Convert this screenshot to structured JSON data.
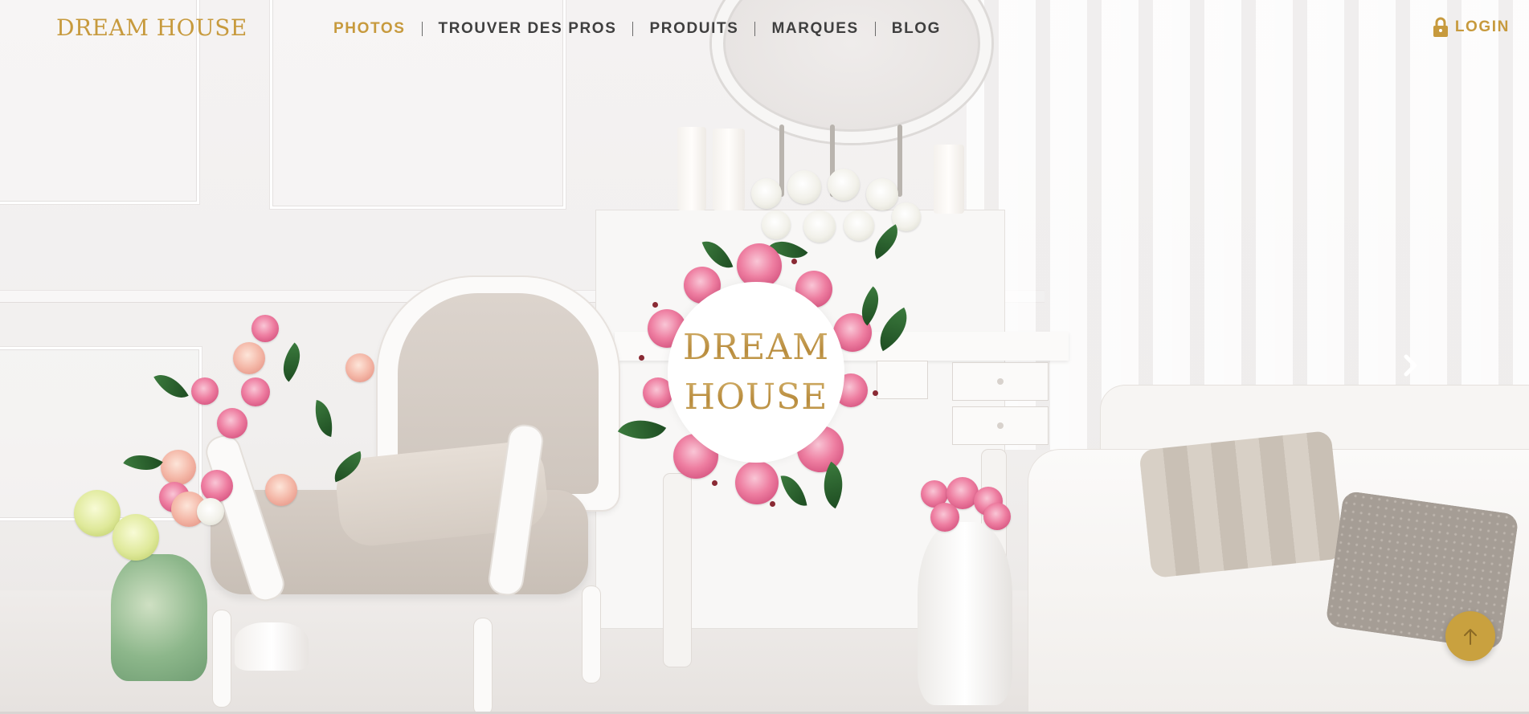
{
  "brand": {
    "name": "DREAM HOUSE"
  },
  "nav": {
    "items": [
      {
        "label": "PHOTOS",
        "active": true
      },
      {
        "label": "TROUVER DES PROS",
        "active": false
      },
      {
        "label": "PRODUITS",
        "active": false
      },
      {
        "label": "MARQUES",
        "active": false
      },
      {
        "label": "BLOG",
        "active": false
      }
    ]
  },
  "account": {
    "login_label": "LOGIN",
    "icon": "lock-icon"
  },
  "hero": {
    "logo_line_1": "DREAM",
    "logo_line_2": "HOUSE",
    "next_icon": "chevron-right-icon"
  },
  "scroll_top": {
    "icon": "arrow-up-icon"
  },
  "colors": {
    "accent_gold": "#c79a3d",
    "nav_text": "#3f3f3f",
    "scroll_button": "#c9a13f"
  }
}
